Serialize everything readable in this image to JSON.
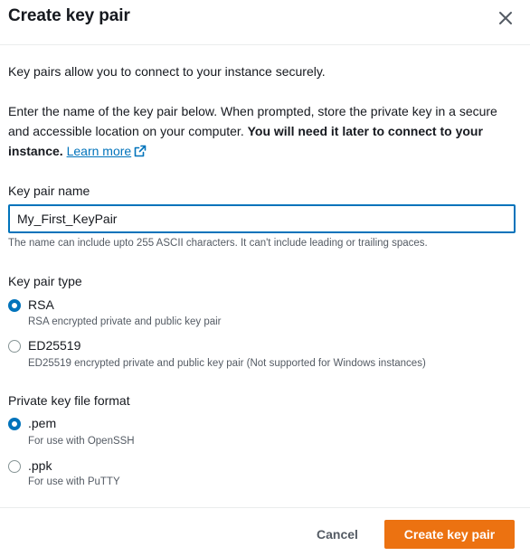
{
  "dialog": {
    "title": "Create key pair",
    "close_icon": "close-icon"
  },
  "intro": {
    "line1": "Key pairs allow you to connect to your instance securely.",
    "line2_part1": "Enter the name of the key pair below. When prompted, store the private key in a secure and accessible location on your computer.",
    "line2_bold": "You will need it later to connect to your instance.",
    "learn_more": "Learn more",
    "external_icon": "external-link-icon"
  },
  "key_name": {
    "label": "Key pair name",
    "value": "My_First_KeyPair",
    "hint": "The name can include upto 255 ASCII characters. It can't include leading or trailing spaces."
  },
  "key_type": {
    "label": "Key pair type",
    "options": [
      {
        "label": "RSA",
        "description": "RSA encrypted private and public key pair",
        "selected": true
      },
      {
        "label": "ED25519",
        "description": "ED25519 encrypted private and public key pair (Not supported for Windows instances)",
        "selected": false
      }
    ]
  },
  "file_format": {
    "label": "Private key file format",
    "options": [
      {
        "label": ".pem",
        "description": "For use with OpenSSH",
        "selected": true
      },
      {
        "label": ".ppk",
        "description": "For use with PuTTY",
        "selected": false
      }
    ]
  },
  "footer": {
    "cancel_label": "Cancel",
    "create_label": "Create key pair"
  },
  "colors": {
    "accent": "#0073bb",
    "primary_button": "#ec7211",
    "text": "#16191f",
    "muted": "#545b64"
  }
}
